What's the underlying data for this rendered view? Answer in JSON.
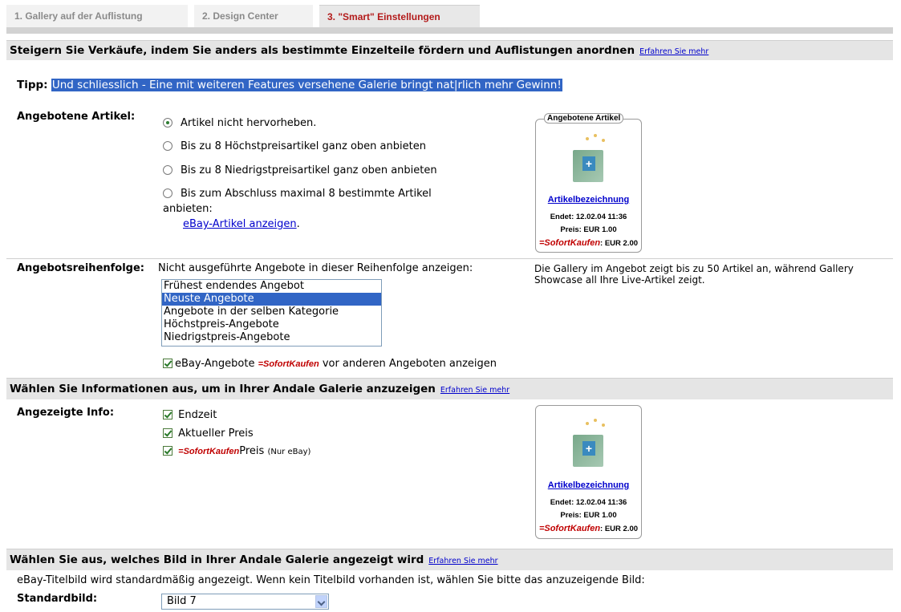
{
  "tabs": [
    "1. Gallery auf der Auflistung",
    "2. Design Center",
    "3. \"Smart\" Einstellungen"
  ],
  "section1": {
    "heading": "Steigern Sie Verkäufe, indem Sie anders als bestimmte Einzelteile fördern und Auflistungen anordnen",
    "learn_more": "Erfahren Sie mehr"
  },
  "tip": {
    "label": "Tipp:",
    "text": "Und schliesslich - Eine mit weiteren Features versehene Galerie bringt nat|rlich mehr Gewinn!"
  },
  "featured": {
    "label": "Angebotene Artikel:",
    "options": [
      "Artikel nicht hervorheben.",
      "Bis zu 8 Höchstpreisartikel ganz oben anbieten",
      "Bis zu 8 Niedrigstpreisartikel ganz oben anbieten",
      "Bis zum Abschluss maximal 8 bestimmte Artikel",
      "anbieten:"
    ],
    "link": "eBay-Artikel anzeigen",
    "link_suffix": ".",
    "selected_index": 0
  },
  "preview1": {
    "title": "Angebotene Artikel",
    "name": "Artikelbezeichnung",
    "end": "Endet: 12.02.04 11:36",
    "price": "Preis: EUR 1.00",
    "sofort_price": ": EUR 2.00"
  },
  "order": {
    "label": "Angebotsreihenfolge:",
    "intro": "Nicht ausgeführte Angebote in dieser Reihenfolge anzeigen:",
    "options": [
      "Frühest endendes Angebot",
      "Neuste Angebote",
      "Angebote in der selben Kategorie",
      "Höchstpreis-Angebote",
      "Niedrigstpreis-Angebote"
    ],
    "selected_index": 1,
    "checkbox_before": "eBay-Angebote",
    "checkbox_after": "vor anderen Angeboten anzeigen",
    "note": "Die Gallery im Angebot zeigt bis zu 50 Artikel an, während Gallery Showcase all Ihre Live-Artikel zeigt."
  },
  "sofort_logo": {
    "part1": "=Sofort",
    "part2": "Kaufen"
  },
  "section2": {
    "heading": "Wählen Sie Informationen aus, um in Ihrer Andale Galerie anzuzeigen",
    "learn_more": "Erfahren Sie mehr"
  },
  "info": {
    "label": "Angezeigte Info:",
    "items": [
      "Endzeit",
      "Aktueller Preis"
    ],
    "sofort_item": "Preis",
    "sofort_note": "(Nur eBay)"
  },
  "preview2": {
    "name": "Artikelbezeichnung",
    "end": "Endet: 12.02.04 11:36",
    "price": "Preis: EUR 1.00",
    "sofort_price": ": EUR 2.00"
  },
  "section3": {
    "heading": "Wählen Sie aus, welches Bild in Ihrer Andale Galerie angezeigt wird",
    "learn_more": "Erfahren Sie mehr"
  },
  "image": {
    "description": "eBay-Titelbild wird standardmäßig angezeigt. Wenn kein Titelbild vorhanden ist, wählen Sie bitte das anzuzeigende Bild:",
    "label": "Standardbild:",
    "value": "Bild 7"
  }
}
